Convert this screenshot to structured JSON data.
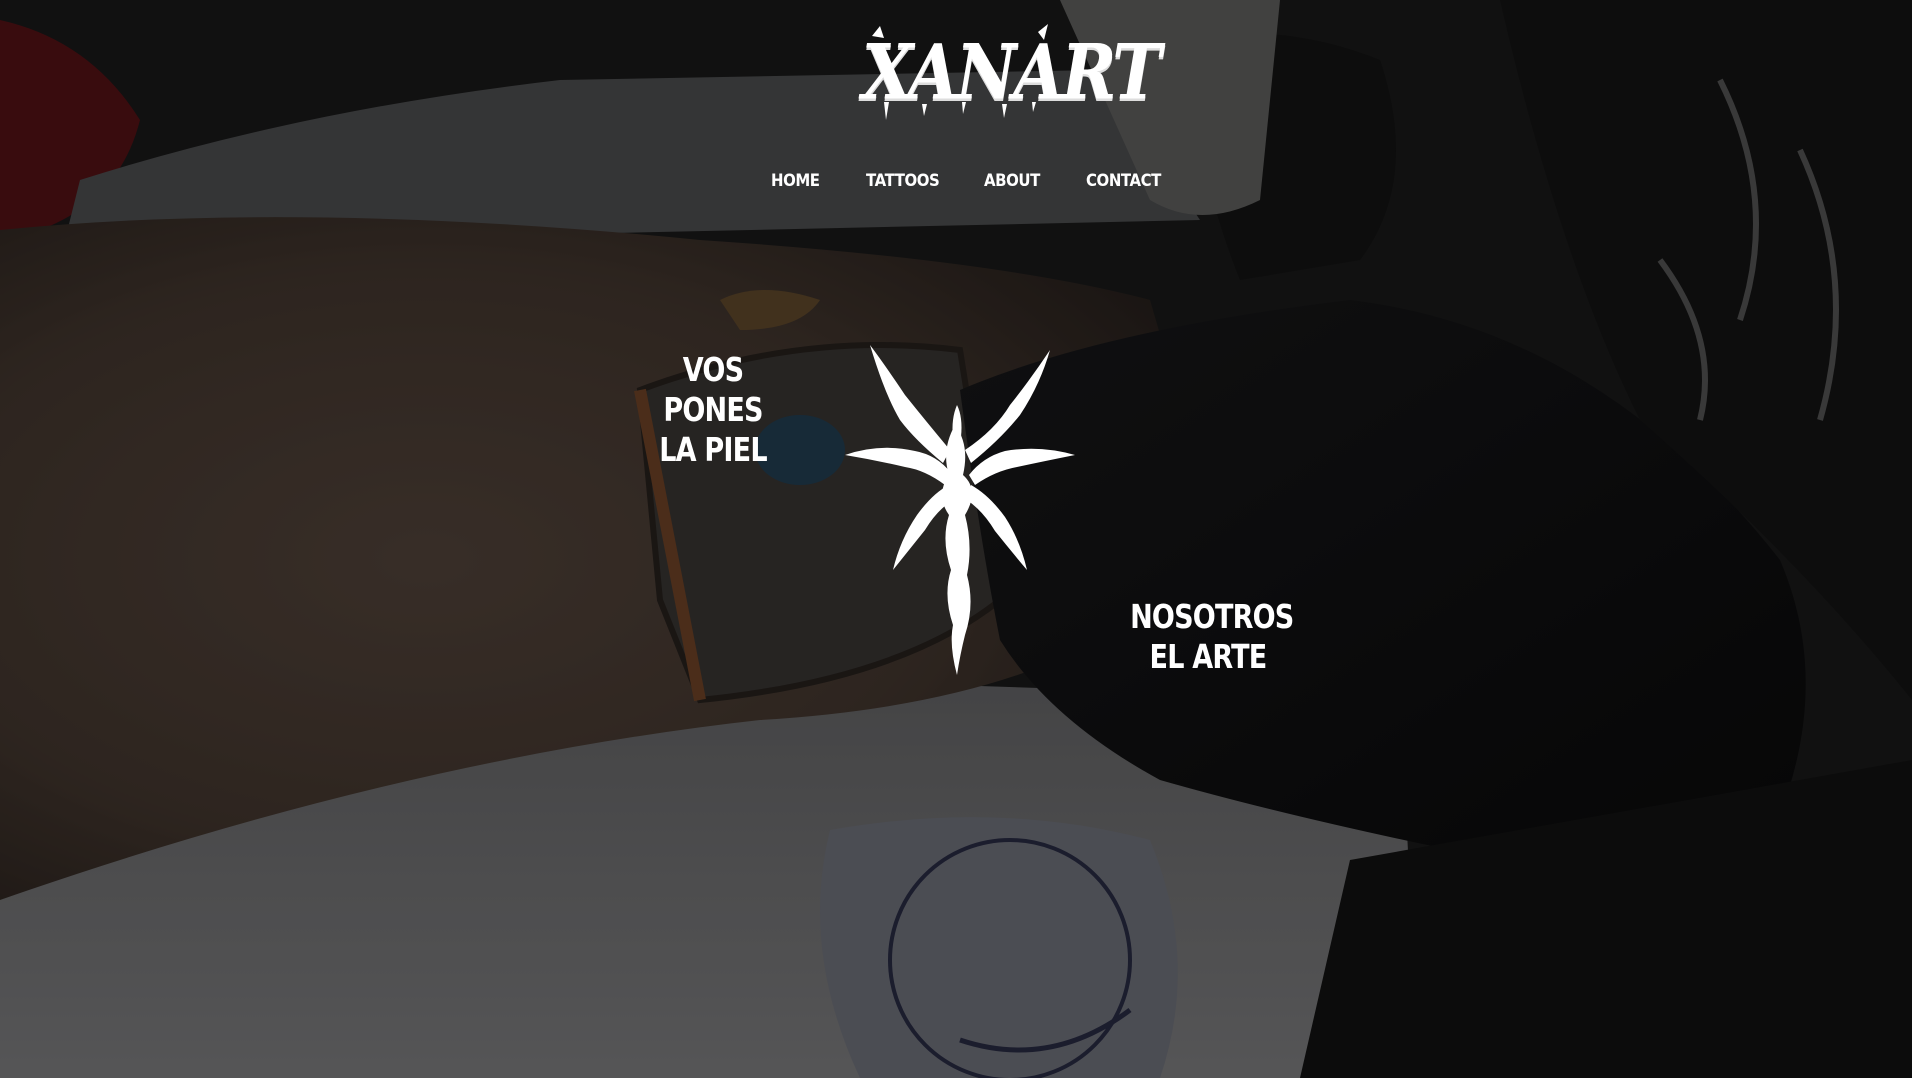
{
  "brand": {
    "logo_text": "XANART"
  },
  "nav": {
    "items": [
      {
        "id": "home",
        "label": "HOME"
      },
      {
        "id": "tattoos",
        "label": "TATTOOS"
      },
      {
        "id": "about",
        "label": "ABOUT"
      },
      {
        "id": "contact",
        "label": "CONTACT"
      }
    ]
  },
  "hero": {
    "left_tagline": [
      "VOS PONES",
      "LA PIEL"
    ],
    "right_tagline": [
      "NOSOTROS",
      "EL ARTE"
    ],
    "emblem_icon": "spiked-star-emblem-icon",
    "background": "tattoo-session-photo"
  },
  "colors": {
    "text": "#ffffff",
    "overlay": "#000000"
  }
}
